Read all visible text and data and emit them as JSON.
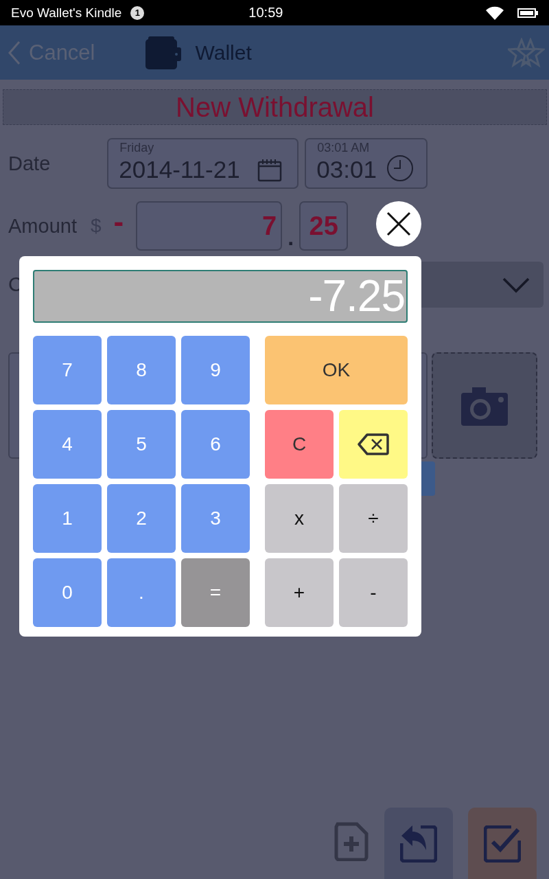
{
  "status_bar": {
    "device": "Evo Wallet's Kindle",
    "notification_count": "1",
    "time": "10:59"
  },
  "header": {
    "back": "Cancel",
    "title": "Wallet"
  },
  "form": {
    "title": "New Withdrawal",
    "date_label": "Date",
    "date": {
      "weekday": "Friday",
      "value": "2014-11-21"
    },
    "time": {
      "hint": "03:01 AM",
      "value": "03:01"
    },
    "amount_label": "Amount",
    "currency": "$",
    "sign": "-",
    "amount_whole": "7",
    "decimal_point": ".",
    "amount_cents": "25",
    "category_label": "C"
  },
  "calculator": {
    "display": "-7.25",
    "number_pad": [
      {
        "kind": "digit",
        "label": "7"
      },
      {
        "kind": "digit",
        "label": "8"
      },
      {
        "kind": "digit",
        "label": "9"
      },
      {
        "kind": "digit",
        "label": "4"
      },
      {
        "kind": "digit",
        "label": "5"
      },
      {
        "kind": "digit",
        "label": "6"
      },
      {
        "kind": "digit",
        "label": "1"
      },
      {
        "kind": "digit",
        "label": "2"
      },
      {
        "kind": "digit",
        "label": "3"
      },
      {
        "kind": "digit",
        "label": "0"
      },
      {
        "kind": "digit",
        "label": "."
      },
      {
        "kind": "equals",
        "label": "="
      }
    ],
    "function_pad": [
      {
        "kind": "ok",
        "label": "OK"
      },
      {
        "kind": "clear",
        "label": "C"
      },
      {
        "kind": "backspace"
      },
      {
        "kind": "operator",
        "label": "x"
      },
      {
        "kind": "operator",
        "label": "÷"
      },
      {
        "kind": "operator",
        "label": "+"
      },
      {
        "kind": "operator",
        "label": "-"
      }
    ]
  }
}
